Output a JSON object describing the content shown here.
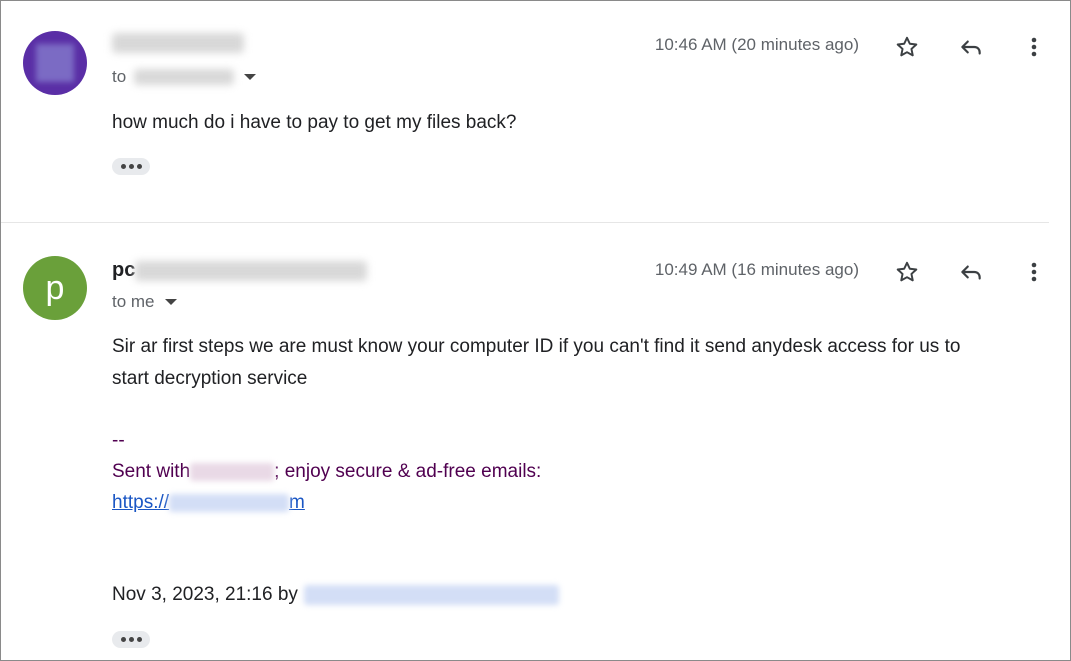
{
  "messages": [
    {
      "avatar_letter": "",
      "avatar_color": "#5a2ea6",
      "sender_prefix": "",
      "to_label": "to",
      "time": "10:46 AM (20 minutes ago)",
      "body": "how much do i have to pay to get my files back?"
    },
    {
      "avatar_letter": "p",
      "avatar_color": "#6aa03a",
      "sender_prefix": "pc",
      "to_label": "to me",
      "time": "10:49 AM (16 minutes ago)",
      "body_line1": "Sir ar first steps we are must know your computer ID if you can't find it send anydesk access for us to",
      "body_line2": "start decryption service",
      "sig_dashes": "--",
      "sig_sent_with": "Sent with",
      "sig_rest": "; enjoy secure & ad-free emails:",
      "sig_link_prefix": "https://",
      "sig_link_suffix": "m",
      "footer": "Nov 3, 2023, 21:16 by"
    }
  ],
  "icons": {
    "star": "star-icon",
    "reply": "reply-icon",
    "more": "more-vert-icon"
  }
}
